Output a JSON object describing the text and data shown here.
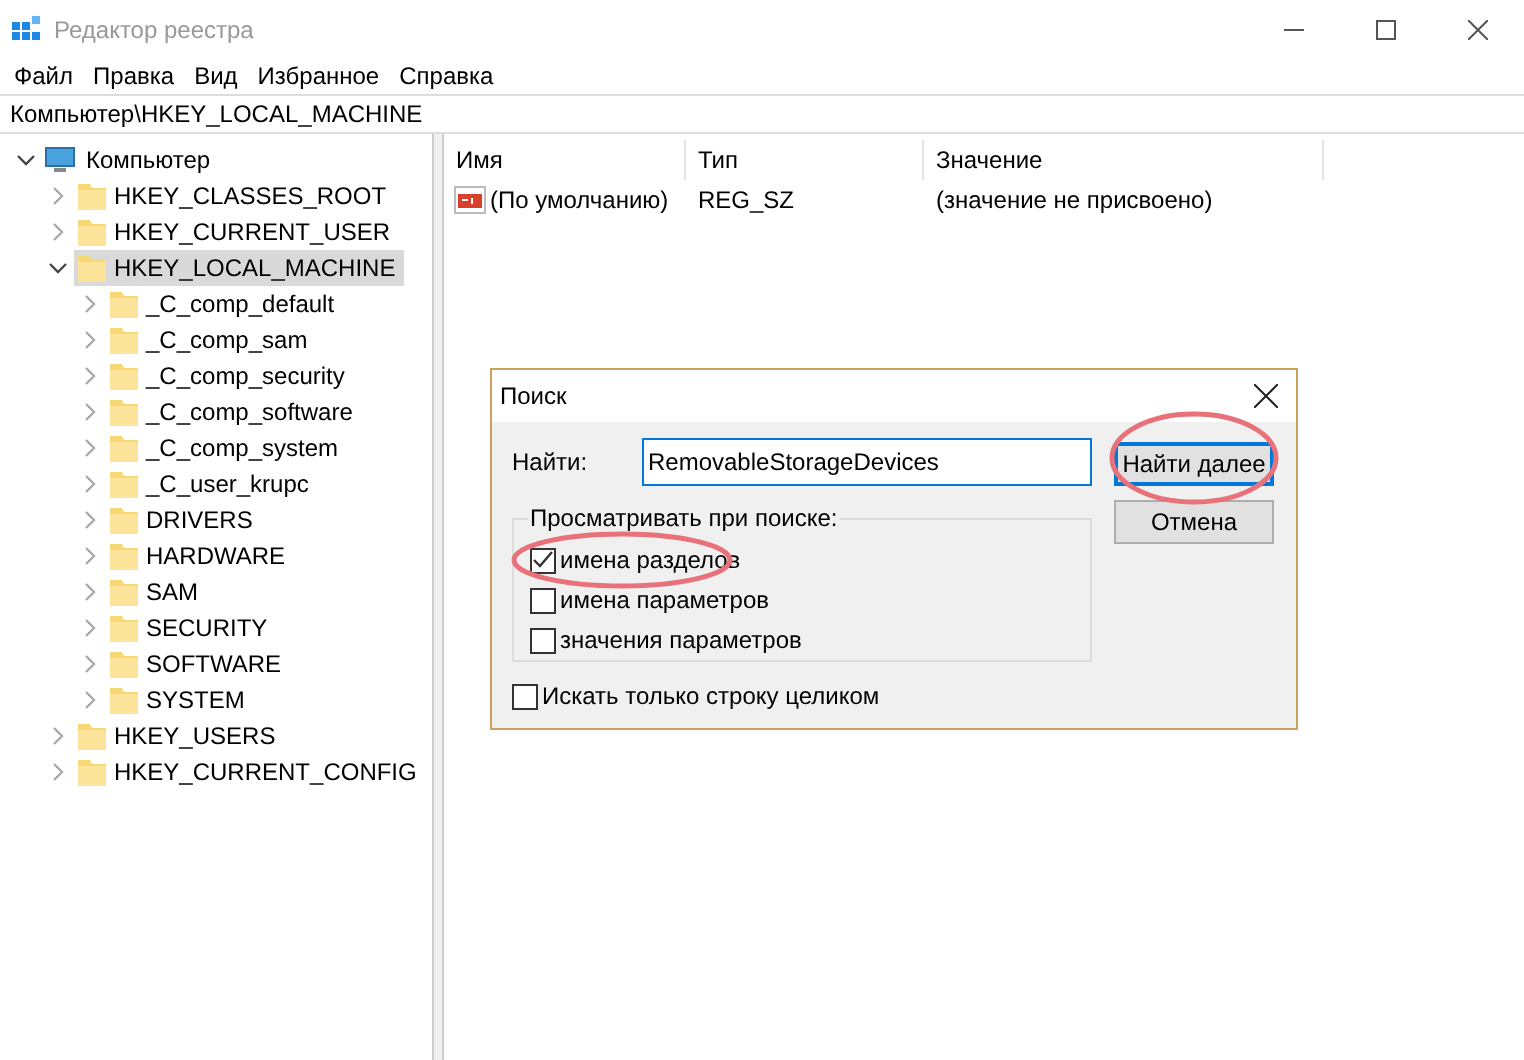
{
  "window": {
    "title": "Редактор реестра"
  },
  "menu": [
    "Файл",
    "Правка",
    "Вид",
    "Избранное",
    "Справка"
  ],
  "address": "Компьютер\\HKEY_LOCAL_MACHINE",
  "tree": [
    {
      "label": "Компьютер",
      "kind": "computer",
      "expanded": true,
      "selected": false,
      "children": [
        {
          "label": "HKEY_CLASSES_ROOT",
          "kind": "folder",
          "expanded": false,
          "selected": false
        },
        {
          "label": "HKEY_CURRENT_USER",
          "kind": "folder",
          "expanded": false,
          "selected": false
        },
        {
          "label": "HKEY_LOCAL_MACHINE",
          "kind": "folder",
          "expanded": true,
          "selected": true,
          "children": [
            {
              "label": "_C_comp_default",
              "kind": "folder",
              "expanded": false,
              "selected": false
            },
            {
              "label": "_C_comp_sam",
              "kind": "folder",
              "expanded": false,
              "selected": false
            },
            {
              "label": "_C_comp_security",
              "kind": "folder",
              "expanded": false,
              "selected": false
            },
            {
              "label": "_C_comp_software",
              "kind": "folder",
              "expanded": false,
              "selected": false
            },
            {
              "label": "_C_comp_system",
              "kind": "folder",
              "expanded": false,
              "selected": false
            },
            {
              "label": "_C_user_krupc",
              "kind": "folder",
              "expanded": false,
              "selected": false
            },
            {
              "label": "DRIVERS",
              "kind": "folder",
              "expanded": false,
              "selected": false
            },
            {
              "label": "HARDWARE",
              "kind": "folder",
              "expanded": false,
              "selected": false
            },
            {
              "label": "SAM",
              "kind": "folder",
              "expanded": false,
              "selected": false
            },
            {
              "label": "SECURITY",
              "kind": "folder",
              "expanded": false,
              "selected": false
            },
            {
              "label": "SOFTWARE",
              "kind": "folder",
              "expanded": false,
              "selected": false
            },
            {
              "label": "SYSTEM",
              "kind": "folder",
              "expanded": false,
              "selected": false
            }
          ]
        },
        {
          "label": "HKEY_USERS",
          "kind": "folder",
          "expanded": false,
          "selected": false
        },
        {
          "label": "HKEY_CURRENT_CONFIG",
          "kind": "folder",
          "expanded": false,
          "selected": false
        }
      ]
    }
  ],
  "list": {
    "columns": [
      "Имя",
      "Тип",
      "Значение"
    ],
    "rows": [
      {
        "name": "(По умолчанию)",
        "type": "REG_SZ",
        "value": "(значение не присвоено)"
      }
    ]
  },
  "dialog": {
    "title": "Поиск",
    "find_label": "Найти:",
    "find_value": "RemovableStorageDevices",
    "buttons": [
      {
        "label": "Найти далее",
        "default": true
      },
      {
        "label": "Отмена",
        "default": false
      }
    ],
    "group": {
      "title": "Просматривать при поиске:",
      "options": [
        {
          "label": "имена разделов",
          "checked": true
        },
        {
          "label": "имена параметров",
          "checked": false
        },
        {
          "label": "значения параметров",
          "checked": false
        }
      ]
    },
    "whole_string": {
      "label": "Искать только строку целиком",
      "checked": false
    }
  }
}
